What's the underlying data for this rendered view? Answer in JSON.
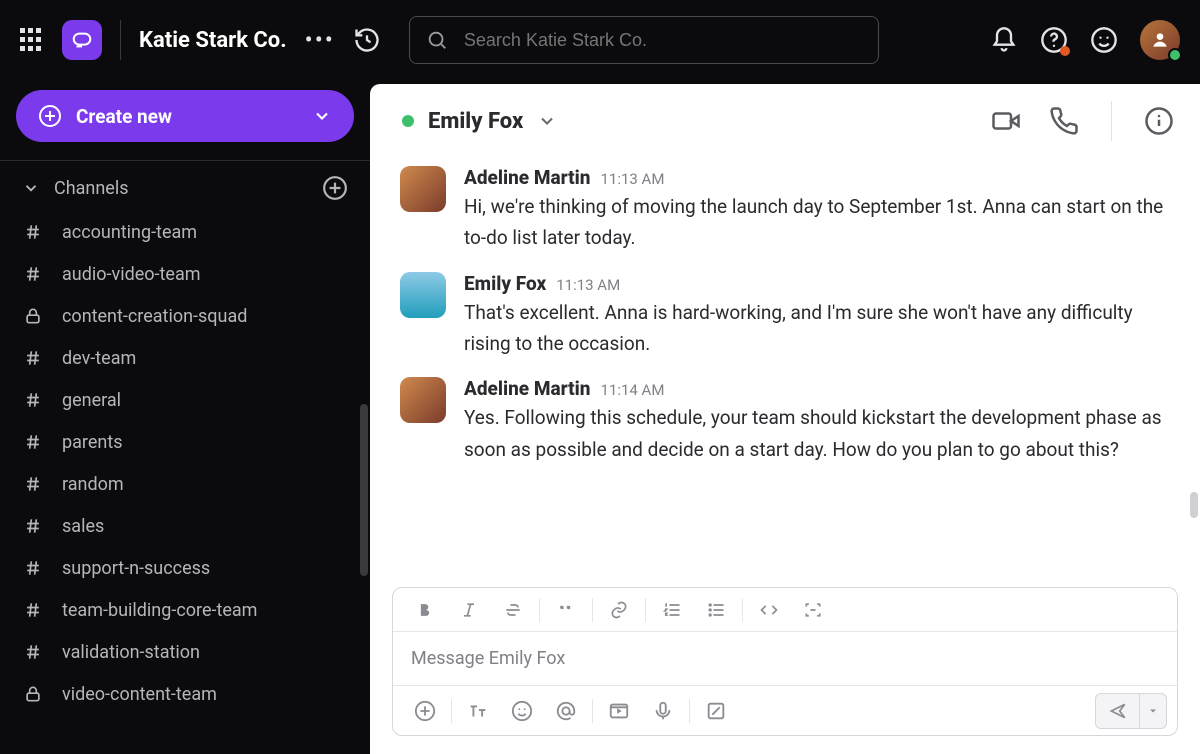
{
  "workspace": {
    "name": "Katie Stark Co."
  },
  "search": {
    "placeholder": "Search Katie Stark Co."
  },
  "sidebar": {
    "create_label": "Create new",
    "channels_label": "Channels",
    "channels": [
      {
        "name": "accounting-team",
        "private": false
      },
      {
        "name": "audio-video-team",
        "private": false
      },
      {
        "name": "content-creation-squad",
        "private": true
      },
      {
        "name": "dev-team",
        "private": false
      },
      {
        "name": "general",
        "private": false
      },
      {
        "name": "parents",
        "private": false
      },
      {
        "name": "random",
        "private": false
      },
      {
        "name": "sales",
        "private": false
      },
      {
        "name": "support-n-success",
        "private": false
      },
      {
        "name": "team-building-core-team",
        "private": false
      },
      {
        "name": "validation-station",
        "private": false
      },
      {
        "name": "video-content-team",
        "private": true
      }
    ]
  },
  "chat": {
    "title": "Emily Fox",
    "composer_placeholder": "Message Emily Fox",
    "messages": [
      {
        "author": "Adeline Martin",
        "time": "11:13 AM",
        "avatar": "adeline",
        "text": "Hi, we're thinking of moving the launch day to September 1st. Anna can start on the to-do list later today."
      },
      {
        "author": "Emily Fox",
        "time": "11:13 AM",
        "avatar": "emily",
        "text": "That's excellent. Anna is hard-working, and I'm sure she won't have any difficulty rising to the occasion."
      },
      {
        "author": "Adeline Martin",
        "time": "11:14 AM",
        "avatar": "adeline",
        "text": "Yes. Following this schedule, your team should kickstart the development phase as soon as possible and decide on a start day. How do you plan to go about this?"
      }
    ]
  }
}
